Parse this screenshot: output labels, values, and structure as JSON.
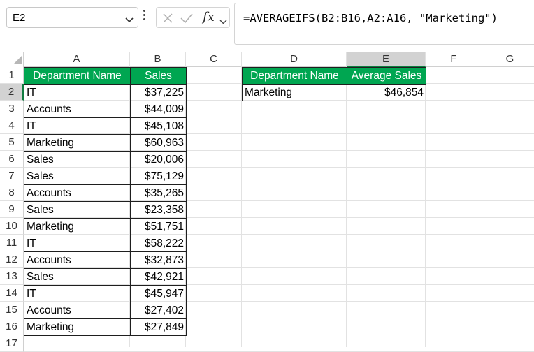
{
  "name_box": {
    "value": "E2"
  },
  "formula_bar": {
    "fx_label": "fx",
    "formula": "=AVERAGEIFS(B2:B16,A2:A16, \"Marketing\")"
  },
  "columns": [
    "A",
    "B",
    "C",
    "D",
    "E",
    "F",
    "G"
  ],
  "rows": [
    "1",
    "2",
    "3",
    "4",
    "5",
    "6",
    "7",
    "8",
    "9",
    "10",
    "11",
    "12",
    "13",
    "14",
    "15",
    "16",
    "17"
  ],
  "active_cell": {
    "column": "E",
    "row": "2"
  },
  "colors": {
    "header_fill": "#00a651",
    "header_text": "#ffffff",
    "selection": "#107c41"
  },
  "table1": {
    "headers": [
      "Department Name",
      "Sales"
    ],
    "rows": [
      [
        "IT",
        "$37,225"
      ],
      [
        "Accounts",
        "$44,009"
      ],
      [
        "IT",
        "$45,108"
      ],
      [
        "Marketing",
        "$60,963"
      ],
      [
        "Sales",
        "$20,006"
      ],
      [
        "Sales",
        "$75,129"
      ],
      [
        "Accounts",
        "$35,265"
      ],
      [
        "Sales",
        "$23,358"
      ],
      [
        "Marketing",
        "$51,751"
      ],
      [
        "IT",
        "$58,222"
      ],
      [
        "Accounts",
        "$32,873"
      ],
      [
        "Sales",
        "$42,921"
      ],
      [
        "IT",
        "$45,947"
      ],
      [
        "Accounts",
        "$27,402"
      ],
      [
        "Marketing",
        "$27,849"
      ]
    ]
  },
  "table2": {
    "headers": [
      "Department Name",
      "Average Sales"
    ],
    "rows": [
      [
        "Marketing",
        "$46,854"
      ]
    ]
  }
}
